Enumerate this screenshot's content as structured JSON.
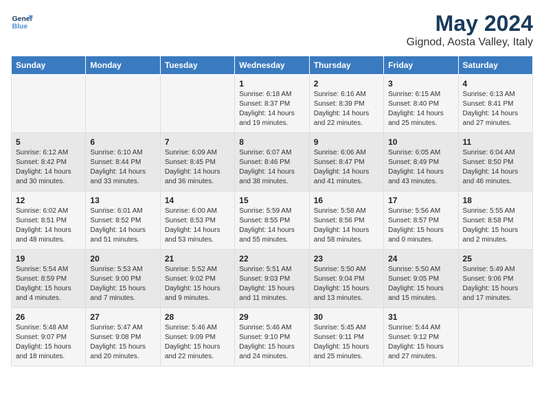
{
  "header": {
    "logo_line1": "General",
    "logo_line2": "Blue",
    "main_title": "May 2024",
    "subtitle": "Gignod, Aosta Valley, Italy"
  },
  "days_of_week": [
    "Sunday",
    "Monday",
    "Tuesday",
    "Wednesday",
    "Thursday",
    "Friday",
    "Saturday"
  ],
  "weeks": [
    [
      {
        "day": "",
        "info": ""
      },
      {
        "day": "",
        "info": ""
      },
      {
        "day": "",
        "info": ""
      },
      {
        "day": "1",
        "info": "Sunrise: 6:18 AM\nSunset: 8:37 PM\nDaylight: 14 hours\nand 19 minutes."
      },
      {
        "day": "2",
        "info": "Sunrise: 6:16 AM\nSunset: 8:39 PM\nDaylight: 14 hours\nand 22 minutes."
      },
      {
        "day": "3",
        "info": "Sunrise: 6:15 AM\nSunset: 8:40 PM\nDaylight: 14 hours\nand 25 minutes."
      },
      {
        "day": "4",
        "info": "Sunrise: 6:13 AM\nSunset: 8:41 PM\nDaylight: 14 hours\nand 27 minutes."
      }
    ],
    [
      {
        "day": "5",
        "info": "Sunrise: 6:12 AM\nSunset: 8:42 PM\nDaylight: 14 hours\nand 30 minutes."
      },
      {
        "day": "6",
        "info": "Sunrise: 6:10 AM\nSunset: 8:44 PM\nDaylight: 14 hours\nand 33 minutes."
      },
      {
        "day": "7",
        "info": "Sunrise: 6:09 AM\nSunset: 8:45 PM\nDaylight: 14 hours\nand 36 minutes."
      },
      {
        "day": "8",
        "info": "Sunrise: 6:07 AM\nSunset: 8:46 PM\nDaylight: 14 hours\nand 38 minutes."
      },
      {
        "day": "9",
        "info": "Sunrise: 6:06 AM\nSunset: 8:47 PM\nDaylight: 14 hours\nand 41 minutes."
      },
      {
        "day": "10",
        "info": "Sunrise: 6:05 AM\nSunset: 8:49 PM\nDaylight: 14 hours\nand 43 minutes."
      },
      {
        "day": "11",
        "info": "Sunrise: 6:04 AM\nSunset: 8:50 PM\nDaylight: 14 hours\nand 46 minutes."
      }
    ],
    [
      {
        "day": "12",
        "info": "Sunrise: 6:02 AM\nSunset: 8:51 PM\nDaylight: 14 hours\nand 48 minutes."
      },
      {
        "day": "13",
        "info": "Sunrise: 6:01 AM\nSunset: 8:52 PM\nDaylight: 14 hours\nand 51 minutes."
      },
      {
        "day": "14",
        "info": "Sunrise: 6:00 AM\nSunset: 8:53 PM\nDaylight: 14 hours\nand 53 minutes."
      },
      {
        "day": "15",
        "info": "Sunrise: 5:59 AM\nSunset: 8:55 PM\nDaylight: 14 hours\nand 55 minutes."
      },
      {
        "day": "16",
        "info": "Sunrise: 5:58 AM\nSunset: 8:56 PM\nDaylight: 14 hours\nand 58 minutes."
      },
      {
        "day": "17",
        "info": "Sunrise: 5:56 AM\nSunset: 8:57 PM\nDaylight: 15 hours\nand 0 minutes."
      },
      {
        "day": "18",
        "info": "Sunrise: 5:55 AM\nSunset: 8:58 PM\nDaylight: 15 hours\nand 2 minutes."
      }
    ],
    [
      {
        "day": "19",
        "info": "Sunrise: 5:54 AM\nSunset: 8:59 PM\nDaylight: 15 hours\nand 4 minutes."
      },
      {
        "day": "20",
        "info": "Sunrise: 5:53 AM\nSunset: 9:00 PM\nDaylight: 15 hours\nand 7 minutes."
      },
      {
        "day": "21",
        "info": "Sunrise: 5:52 AM\nSunset: 9:02 PM\nDaylight: 15 hours\nand 9 minutes."
      },
      {
        "day": "22",
        "info": "Sunrise: 5:51 AM\nSunset: 9:03 PM\nDaylight: 15 hours\nand 11 minutes."
      },
      {
        "day": "23",
        "info": "Sunrise: 5:50 AM\nSunset: 9:04 PM\nDaylight: 15 hours\nand 13 minutes."
      },
      {
        "day": "24",
        "info": "Sunrise: 5:50 AM\nSunset: 9:05 PM\nDaylight: 15 hours\nand 15 minutes."
      },
      {
        "day": "25",
        "info": "Sunrise: 5:49 AM\nSunset: 9:06 PM\nDaylight: 15 hours\nand 17 minutes."
      }
    ],
    [
      {
        "day": "26",
        "info": "Sunrise: 5:48 AM\nSunset: 9:07 PM\nDaylight: 15 hours\nand 18 minutes."
      },
      {
        "day": "27",
        "info": "Sunrise: 5:47 AM\nSunset: 9:08 PM\nDaylight: 15 hours\nand 20 minutes."
      },
      {
        "day": "28",
        "info": "Sunrise: 5:46 AM\nSunset: 9:09 PM\nDaylight: 15 hours\nand 22 minutes."
      },
      {
        "day": "29",
        "info": "Sunrise: 5:46 AM\nSunset: 9:10 PM\nDaylight: 15 hours\nand 24 minutes."
      },
      {
        "day": "30",
        "info": "Sunrise: 5:45 AM\nSunset: 9:11 PM\nDaylight: 15 hours\nand 25 minutes."
      },
      {
        "day": "31",
        "info": "Sunrise: 5:44 AM\nSunset: 9:12 PM\nDaylight: 15 hours\nand 27 minutes."
      },
      {
        "day": "",
        "info": ""
      }
    ]
  ]
}
